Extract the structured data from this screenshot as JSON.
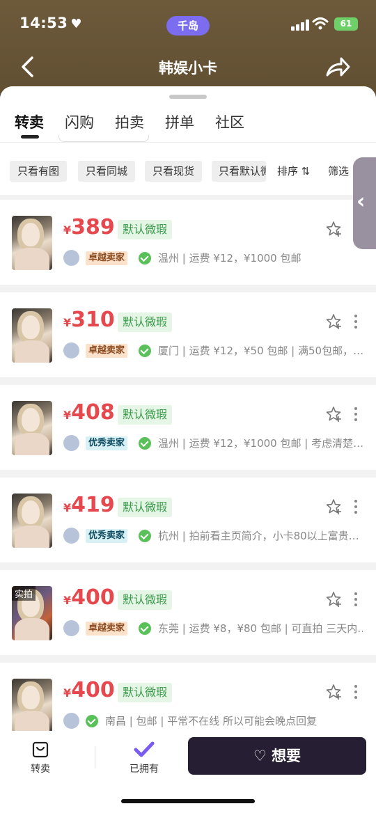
{
  "status_bar": {
    "time": "14:53",
    "island_label": "千岛",
    "battery": "61"
  },
  "header": {
    "title": "韩娱小卡"
  },
  "tabs": [
    "转卖",
    "闪购",
    "拍卖",
    "拼单",
    "社区"
  ],
  "filters": [
    "只看有图",
    "只看同城",
    "只看现货",
    "只看默认微"
  ],
  "sort_label": "排序 ⇅",
  "filter_label": "筛选",
  "listings": [
    {
      "price": "389",
      "tag": "默认微瑕",
      "badge": "卓越卖家",
      "badge_type": "zy",
      "info": "温州 | 运费 ¥12，¥1000 包邮",
      "photo_label": ""
    },
    {
      "price": "310",
      "tag": "默认微瑕",
      "badge": "卓越卖家",
      "badge_type": "zy",
      "info": "厦门 | 运费 ¥12，¥50 包邮 | 满50包邮，…",
      "photo_label": ""
    },
    {
      "price": "408",
      "tag": "默认微瑕",
      "badge": "优秀卖家",
      "badge_type": "yx",
      "info": "温州 | 运费 ¥12，¥1000 包邮 | 考虑清楚…",
      "photo_label": ""
    },
    {
      "price": "419",
      "tag": "默认微瑕",
      "badge": "优秀卖家",
      "badge_type": "yx",
      "info": "杭州 | 拍前看主页简介，小卡80以上富贵…",
      "photo_label": ""
    },
    {
      "price": "400",
      "tag": "默认微瑕",
      "badge": "卓越卖家",
      "badge_type": "zy",
      "info": "东莞 | 运费 ¥8，¥80 包邮 | 可直拍 三天内…",
      "photo_label": "实拍"
    },
    {
      "price": "400",
      "tag": "默认微瑕",
      "badge": "",
      "badge_type": "",
      "info": "南昌 | 包邮 | 平常不在线 所以可能会晚点回复",
      "photo_label": ""
    }
  ],
  "currency_symbol": "¥",
  "bottom_bar": {
    "resell_label": "转卖",
    "owned_label": "已拥有",
    "want_label": "想要"
  },
  "colors": {
    "price": "#e5484d",
    "tag_text": "#3a9b4a",
    "tag_bg": "#e6f6e6",
    "header_bg": "#6d5a3b",
    "want_bg": "#261f33"
  },
  "icons": [
    "back-icon",
    "share-icon",
    "star-add-icon",
    "more-icon",
    "wechat-verified-icon",
    "bag-icon",
    "check-icon",
    "heart-icon"
  ]
}
